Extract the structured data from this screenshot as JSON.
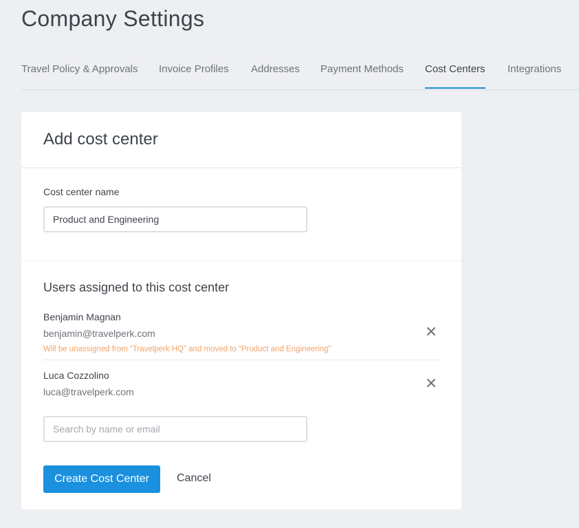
{
  "page": {
    "title": "Company Settings"
  },
  "tabs": [
    {
      "label": "Travel Policy & Approvals",
      "active": false
    },
    {
      "label": "Invoice Profiles",
      "active": false
    },
    {
      "label": "Addresses",
      "active": false
    },
    {
      "label": "Payment Methods",
      "active": false
    },
    {
      "label": "Cost Centers",
      "active": true
    },
    {
      "label": "Integrations",
      "active": false
    }
  ],
  "form": {
    "title": "Add cost center",
    "name_label": "Cost center name",
    "name_value": "Product and Engineering",
    "users_section_title": "Users assigned to this cost center",
    "users": [
      {
        "name": "Benjamin Magnan",
        "email": "benjamin@travelperk.com",
        "warning": "Will be unassigned from “Travelperk HQ” and moved to “Product and Engineering”",
        "remove_icon": "close-icon"
      },
      {
        "name": "Luca Cozzolino",
        "email": "luca@travelperk.com",
        "remove_icon": "close-icon"
      }
    ],
    "search_placeholder": "Search by name or email",
    "search_value": "",
    "create_label": "Create Cost Center",
    "cancel_label": "Cancel"
  },
  "colors": {
    "accent": "#1a90df",
    "background": "#eeeff2",
    "card": "#ffffff",
    "warning_text": "#f0a36a"
  }
}
